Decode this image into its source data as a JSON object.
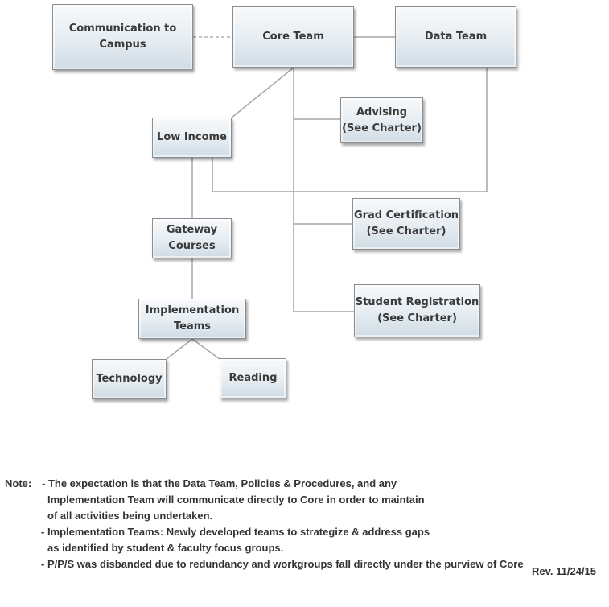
{
  "diagram": {
    "nodes": {
      "communication": {
        "label": "Communication to\nCampus"
      },
      "core": {
        "label": "Core Team"
      },
      "data": {
        "label": "Data Team"
      },
      "advising": {
        "label": "Advising\n(See Charter)"
      },
      "low_income": {
        "label": "Low Income"
      },
      "grad_cert": {
        "label": "Grad Certification\n(See Charter)"
      },
      "student_reg": {
        "label": "Student Registration\n(See Charter)"
      },
      "gateway": {
        "label": "Gateway\nCourses"
      },
      "implementation": {
        "label": "Implementation\nTeams"
      },
      "technology": {
        "label": "Technology"
      },
      "reading": {
        "label": "Reading"
      }
    },
    "edges": [
      {
        "from": "communication",
        "to": "core",
        "style": "dashed"
      },
      {
        "from": "core",
        "to": "data",
        "style": "solid"
      },
      {
        "from": "core",
        "to": "low_income",
        "style": "solid"
      },
      {
        "from": "core",
        "to": "advising",
        "style": "solid"
      },
      {
        "from": "core",
        "to": "grad_cert",
        "style": "solid"
      },
      {
        "from": "core",
        "to": "student_reg",
        "style": "solid"
      },
      {
        "from": "data",
        "to": "low_income",
        "style": "solid"
      },
      {
        "from": "low_income",
        "to": "gateway",
        "style": "solid"
      },
      {
        "from": "gateway",
        "to": "implementation",
        "style": "solid"
      },
      {
        "from": "implementation",
        "to": "technology",
        "style": "solid"
      },
      {
        "from": "implementation",
        "to": "reading",
        "style": "solid"
      }
    ],
    "colors": {
      "line": "#a6a6a6",
      "box_border": "#8c8c8c",
      "box_top": "#f7f9fb",
      "box_bottom": "#cfdbe4"
    }
  },
  "notes": {
    "prefix": "Note:",
    "lines": [
      "- The expectation is that the Data Team, Policies & Procedures, and any",
      "Implementation Team will communicate directly to Core in order to maintain",
      "of all activities being undertaken.",
      "- Implementation Teams: Newly developed teams to strategize & address gaps",
      "as identified by student & faculty focus groups.",
      "- P/P/S was disbanded due to redundancy and workgroups fall directly under the purview of Core"
    ]
  },
  "revision": "Rev. 11/24/15"
}
